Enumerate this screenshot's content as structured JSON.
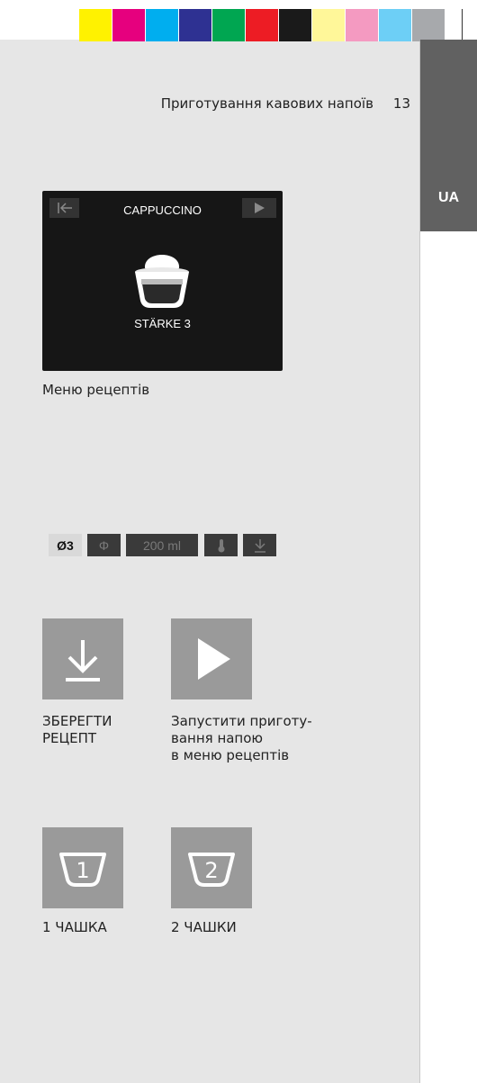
{
  "color_bar": [
    "#fff200",
    "#e6007e",
    "#00aeef",
    "#2e3192",
    "#00a651",
    "#ed1c24",
    "#1a1a1a",
    "#fff799",
    "#f49ac1",
    "#6dcff6",
    "#a7a9ac"
  ],
  "header": {
    "title": "Приготування кавових напоїв",
    "page_number": "13"
  },
  "language_tab": "UA",
  "display": {
    "title": "CAPPUCCINO",
    "strength": "STÄRKE 3",
    "options": {
      "strength_value": "Ø3",
      "volume": "200 ml"
    }
  },
  "captions": {
    "recipe_menu": "Меню рецептів",
    "save_recipe": [
      "ЗБЕРЕГТИ",
      "РЕЦЕПТ"
    ],
    "start_brewing": [
      "Запустити приготу-",
      "вання напою",
      "в меню рецептів"
    ],
    "one_cup": "1 ЧАШКА",
    "two_cups": "2 ЧАШКИ"
  },
  "cup_tiles": {
    "one": "1",
    "two": "2"
  }
}
